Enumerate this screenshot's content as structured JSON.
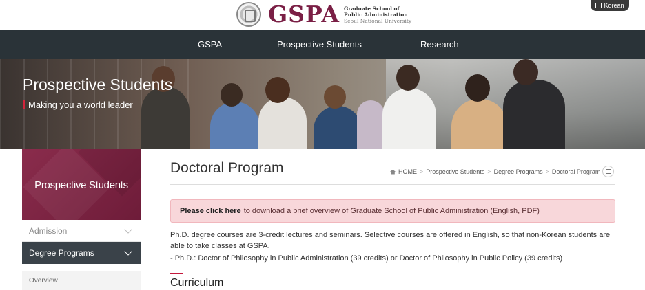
{
  "header": {
    "logo_text": "GSPA",
    "logo_sub": [
      "Graduate School of",
      "Public Administration",
      "Seoul National University"
    ],
    "lang_button": "Korean"
  },
  "nav": {
    "items": [
      "GSPA",
      "Prospective Students",
      "Research"
    ]
  },
  "hero": {
    "title": "Prospective Students",
    "subtitle": "Making you a world leader"
  },
  "sidebar": {
    "title": "Prospective Students",
    "items": [
      {
        "label": "Admission",
        "active": false
      },
      {
        "label": "Degree Programs",
        "active": true
      }
    ],
    "subitems": [
      "Overview"
    ]
  },
  "main": {
    "page_title": "Doctoral Program",
    "breadcrumb": [
      "HOME",
      "Prospective Students",
      "Degree Programs",
      "Doctoral Program"
    ],
    "notice_link": "Please click here",
    "notice_text": "to download a brief overview of Graduate School of Public Administration (English, PDF)",
    "paragraph1": "Ph.D. degree courses are 3-credit lectures and seminars. Selective courses are offered in English, so that non-Korean students are able to take classes at GSPA.",
    "paragraph2": "- Ph.D.: Doctor of Philosophy in Public Administration (39 credits) or Doctor of Philosophy in Public Policy (39 credits)",
    "section_title": "Curriculum"
  },
  "colors": {
    "brand": "#7a1f45",
    "nav_bg": "#2a3338",
    "accent": "#c4183c",
    "notice_bg": "#f8d7da"
  }
}
